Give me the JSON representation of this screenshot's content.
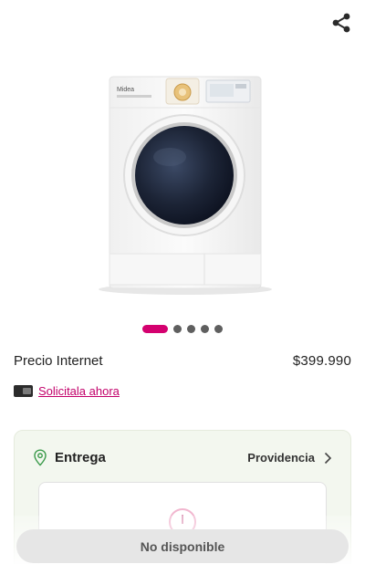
{
  "header": {
    "share_icon": "share-icon"
  },
  "gallery": {
    "image": "front-load-washing-machine",
    "slide_count": 5,
    "active_slide": 1
  },
  "price": {
    "label": "Precio Internet",
    "value": "$399.990"
  },
  "credit": {
    "icon": "credit-card-icon",
    "link_label": "Solicitala ahora"
  },
  "delivery": {
    "icon": "location-pin-icon",
    "title": "Entrega",
    "location": "Providencia",
    "chevron_icon": "chevron-right-icon"
  },
  "cta": {
    "label": "No disponible"
  },
  "colors": {
    "accent": "#d4006f",
    "link": "#c2006a",
    "card_bg": "#f3f7ef"
  }
}
